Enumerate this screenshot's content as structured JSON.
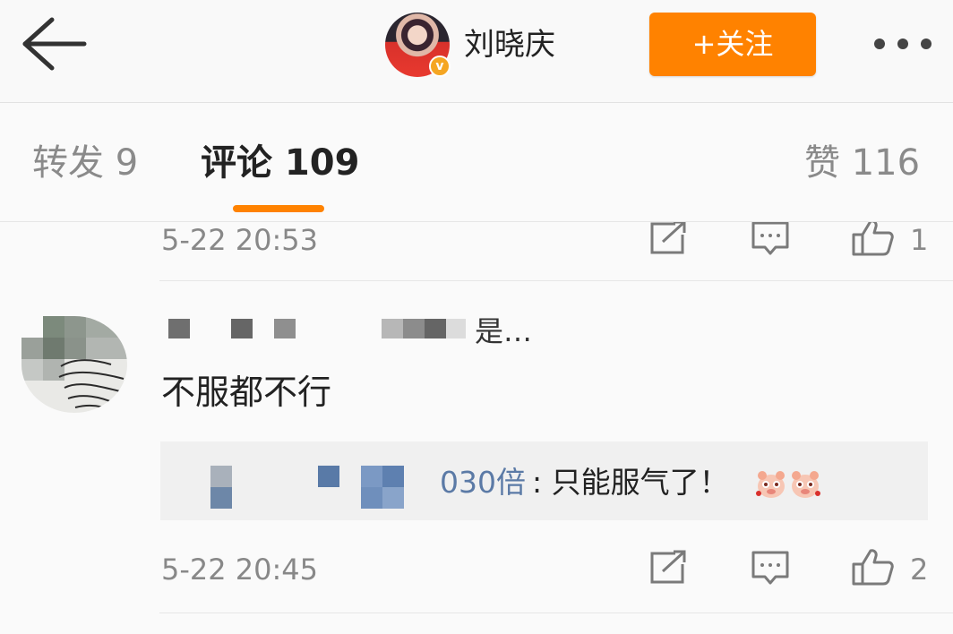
{
  "header": {
    "profile_name": "刘晓庆",
    "follow_label": "+关注",
    "verified_icon": "verified-badge",
    "accent_color": "#ff8200"
  },
  "tabs": [
    {
      "label": "转发 9",
      "active": false
    },
    {
      "label": "评论 109",
      "active": true
    },
    {
      "label": "赞 116",
      "active": false
    }
  ],
  "comments": [
    {
      "timestamp": "5-22 20:53",
      "like_count": "1",
      "actions": [
        "share-icon",
        "comment-icon",
        "like-icon"
      ]
    },
    {
      "username_tail": "是…",
      "text": "不服都不行",
      "reply": {
        "user_tail": "030倍",
        "text": ": 只能服气了！",
        "emojis": [
          "pig-emoji",
          "pig-emoji"
        ]
      },
      "timestamp": "5-22 20:45",
      "like_count": "2",
      "actions": [
        "share-icon",
        "comment-icon",
        "like-icon"
      ]
    }
  ]
}
